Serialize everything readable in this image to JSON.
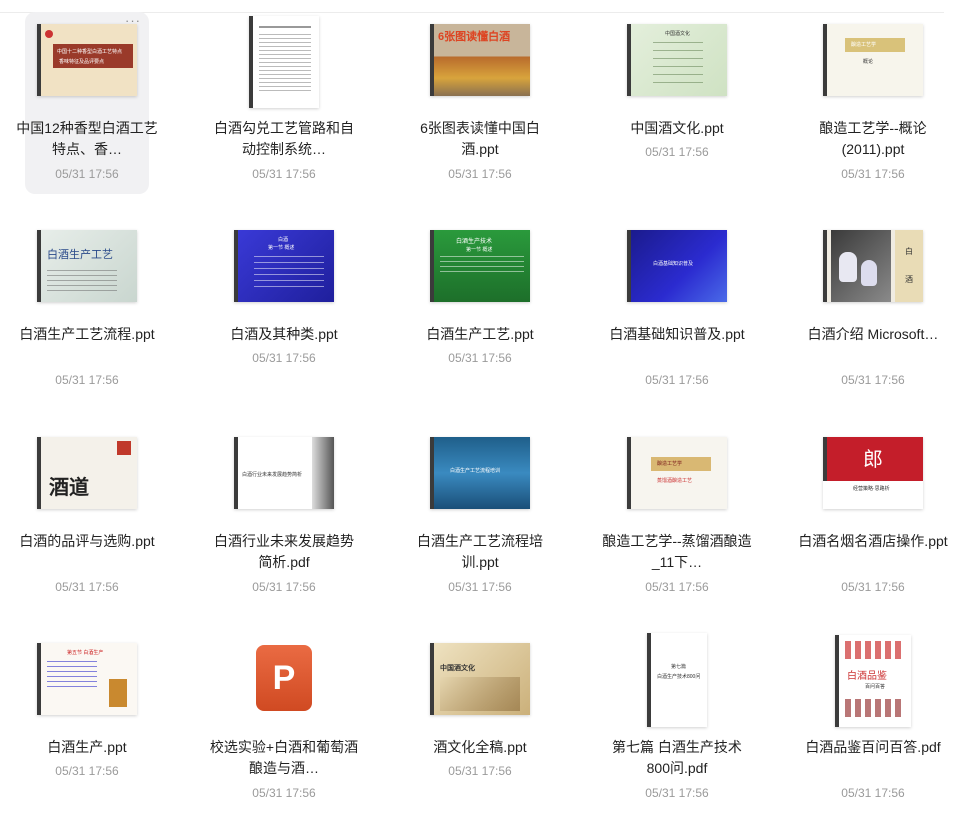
{
  "more_menu": "···",
  "files": [
    {
      "name": "中国12种香型白酒工艺特点、香…",
      "date": "05/31 17:56",
      "kind": "ppt",
      "thumb": [
        "中国十二种香型白酒工艺特点",
        "香味特征及品评要点"
      ]
    },
    {
      "name": "白酒勾兑工艺管路和自动控制系统…",
      "date": "05/31 17:56",
      "kind": "doc",
      "thumb": []
    },
    {
      "name": "6张图表读懂中国白酒.ppt",
      "date": "05/31 17:56",
      "kind": "ppt",
      "thumb": [
        "6张图读懂白酒"
      ]
    },
    {
      "name": "中国酒文化.ppt",
      "date": "05/31 17:56",
      "kind": "ppt",
      "thumb": [
        "中国酒文化"
      ]
    },
    {
      "name": "酿造工艺学--概论(2011).ppt",
      "date": "05/31 17:56",
      "kind": "ppt",
      "thumb": [
        "酿造工艺学",
        "概论"
      ]
    },
    {
      "name": "白酒生产工艺流程.ppt",
      "date": "05/31 17:56",
      "kind": "ppt",
      "thumb": [
        "白酒生产工艺"
      ]
    },
    {
      "name": "白酒及其种类.ppt",
      "date": "05/31 17:56",
      "kind": "ppt",
      "thumb": [
        "白酒",
        "第一节 概述"
      ]
    },
    {
      "name": "白酒生产工艺.ppt",
      "date": "05/31 17:56",
      "kind": "ppt",
      "thumb": [
        "白酒生产技术",
        "第一节 概述"
      ]
    },
    {
      "name": "白酒基础知识普及.ppt",
      "date": "05/31 17:56",
      "kind": "ppt",
      "thumb": [
        "白酒基础知识普及"
      ]
    },
    {
      "name": "白酒介绍 Microsoft…",
      "date": "05/31 17:56",
      "kind": "ppt",
      "thumb": [
        "白",
        "酒"
      ]
    },
    {
      "name": "白酒的品评与选购.ppt",
      "date": "05/31 17:56",
      "kind": "ppt",
      "thumb": [
        "酒道"
      ]
    },
    {
      "name": "白酒行业未来发展趋势简析.pdf",
      "date": "05/31 17:56",
      "kind": "ppt",
      "thumb": [
        "白酒行业未来发展趋势简析"
      ]
    },
    {
      "name": "白酒生产工艺流程培训.ppt",
      "date": "05/31 17:56",
      "kind": "ppt",
      "thumb": [
        "白酒生产工艺流程培训"
      ]
    },
    {
      "name": "酿造工艺学--蒸馏酒酿造_11下…",
      "date": "05/31 17:56",
      "kind": "ppt",
      "thumb": [
        "酿造工艺学",
        "蒸馏酒酿造工艺"
      ]
    },
    {
      "name": "白酒名烟名酒店操作.ppt",
      "date": "05/31 17:56",
      "kind": "ppt",
      "thumb": [
        "郎",
        "经营策略·思路析"
      ]
    },
    {
      "name": "白酒生产.ppt",
      "date": "05/31 17:56",
      "kind": "ppt",
      "thumb": [
        "第五节 白酒生产"
      ]
    },
    {
      "name": "校选实验+白酒和葡萄酒酿造与酒…",
      "date": "05/31 17:56",
      "kind": "pptx",
      "thumb": [
        "P"
      ]
    },
    {
      "name": "酒文化全稿.ppt",
      "date": "05/31 17:56",
      "kind": "ppt",
      "thumb": [
        "中国酒文化"
      ]
    },
    {
      "name": "第七篇 白酒生产技术800问.pdf",
      "date": "05/31 17:56",
      "kind": "pdf",
      "thumb": [
        "第七篇",
        "白酒生产技术800问"
      ]
    },
    {
      "name": "白酒品鉴百问百答.pdf",
      "date": "05/31 17:56",
      "kind": "pdf",
      "thumb": [
        "白酒品鉴",
        "百问百答"
      ]
    }
  ]
}
